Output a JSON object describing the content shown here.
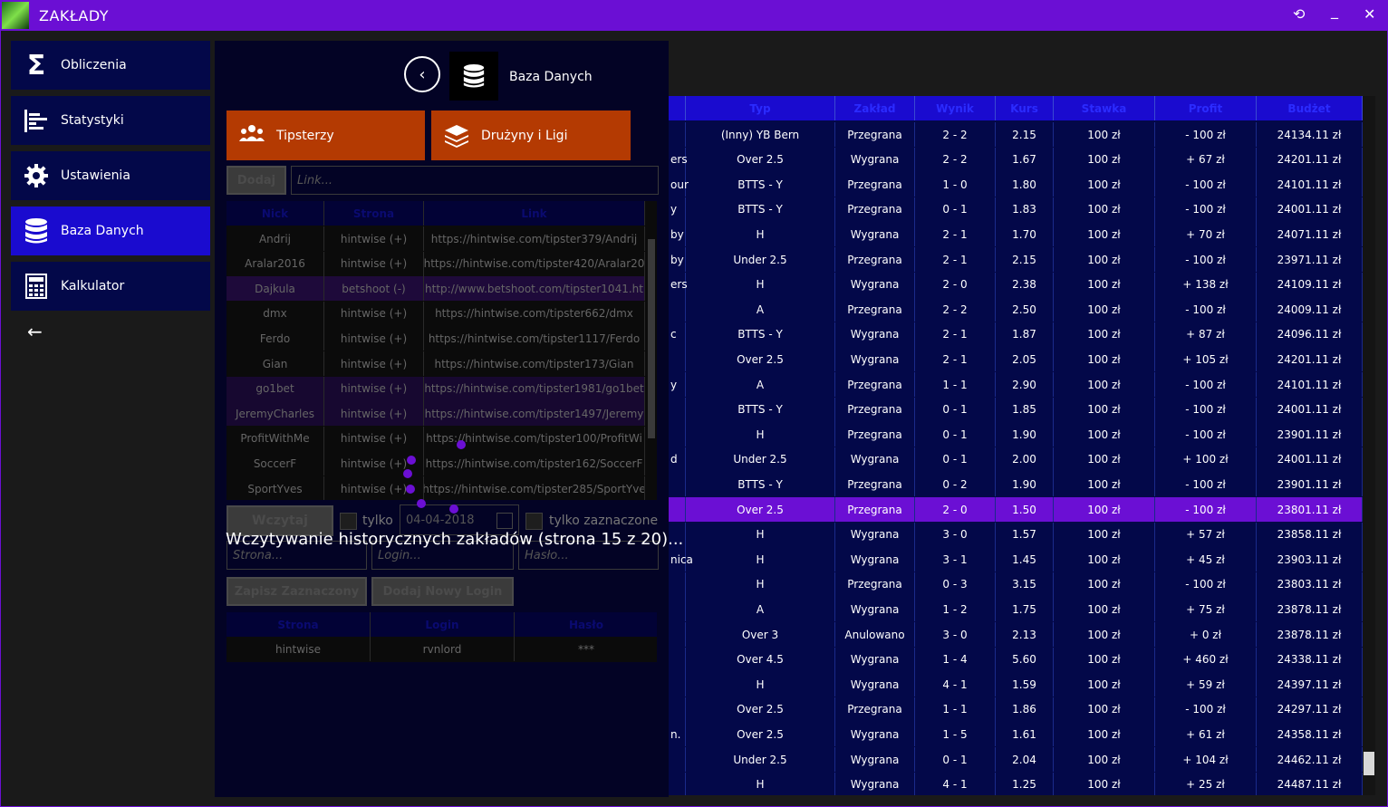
{
  "app": {
    "title": "ZAKŁADY"
  },
  "nav": [
    {
      "label": "Obliczenia",
      "icon": "sigma-icon"
    },
    {
      "label": "Statystyki",
      "icon": "stats-icon"
    },
    {
      "label": "Ustawienia",
      "icon": "gear-icon"
    },
    {
      "label": "Baza Danych",
      "icon": "database-icon"
    },
    {
      "label": "Kalkulator",
      "icon": "calculator-icon"
    }
  ],
  "panel": {
    "title": "Baza Danych",
    "tile_tipsters": "Tipsterzy",
    "tile_teams": "Drużyny i Ligi",
    "add_button": "Dodaj",
    "link_placeholder": "Link...",
    "tipsters_headers": [
      "Nick",
      "Strona",
      "Link"
    ],
    "tipsters": [
      {
        "nick": "Andrij",
        "site": "hintwise (+)",
        "link": "https://hintwise.com/tipster379/Andrij"
      },
      {
        "nick": "Aralar2016",
        "site": "hintwise (+)",
        "link": "https://hintwise.com/tipster420/Aralar20"
      },
      {
        "nick": "Dajkula",
        "site": "betshoot (-)",
        "link": "http://www.betshoot.com/tipster1041.ht"
      },
      {
        "nick": "dmx",
        "site": "hintwise (+)",
        "link": "https://hintwise.com/tipster662/dmx"
      },
      {
        "nick": "Ferdo",
        "site": "hintwise (+)",
        "link": "https://hintwise.com/tipster1117/Ferdo"
      },
      {
        "nick": "Gian",
        "site": "hintwise (+)",
        "link": "https://hintwise.com/tipster173/Gian"
      },
      {
        "nick": "go1bet",
        "site": "hintwise (+)",
        "link": "https://hintwise.com/tipster1981/go1bet"
      },
      {
        "nick": "JeremyCharles",
        "site": "hintwise (+)",
        "link": "https://hintwise.com/tipster1497/Jeremy"
      },
      {
        "nick": "ProfitWithMe",
        "site": "hintwise (+)",
        "link": "https://hintwise.com/tipster100/ProfitWi"
      },
      {
        "nick": "SoccerF",
        "site": "hintwise (+)",
        "link": "https://hintwise.com/tipster162/SoccerF"
      },
      {
        "nick": "SportYves",
        "site": "hintwise (+)",
        "link": "https://hintwise.com/tipster285/SportYve"
      }
    ],
    "load_button": "Wczytaj",
    "only_label": "tylko",
    "date_value": "04-04-2018",
    "only_selected_label": "tylko zaznaczone",
    "loading_text": "Wczytywanie historycznych zakładów (strona 15 z 20)...",
    "page_placeholder": "Strona...",
    "login_placeholder": "Login...",
    "password_placeholder": "Hasło...",
    "save_selected": "Zapisz Zaznaczony",
    "add_login": "Dodaj Nowy Login",
    "logins_headers": [
      "Strona",
      "Login",
      "Hasło"
    ],
    "logins": [
      {
        "site": "hintwise",
        "login": "rvnlord",
        "password": "***"
      }
    ]
  },
  "bets_headers": [
    "Typ",
    "Zakład",
    "Wynik",
    "Kurs",
    "Stawka",
    "Profit",
    "Budżet"
  ],
  "bets": [
    {
      "frag": "",
      "typ": "(Inny) YB Bern",
      "zaklad": "Przegrana",
      "wynik": "2 - 2",
      "kurs": "2.15",
      "stawka": "100 zł",
      "profit": "- 100 zł",
      "budzet": "24134.11 zł"
    },
    {
      "frag": "ers",
      "typ": "Over 2.5",
      "zaklad": "Wygrana",
      "wynik": "2 - 2",
      "kurs": "1.67",
      "stawka": "100 zł",
      "profit": "+ 67 zł",
      "budzet": "24201.11 zł"
    },
    {
      "frag": "our",
      "typ": "BTTS - Y",
      "zaklad": "Przegrana",
      "wynik": "1 - 0",
      "kurs": "1.80",
      "stawka": "100 zł",
      "profit": "- 100 zł",
      "budzet": "24101.11 zł"
    },
    {
      "frag": "y",
      "typ": "BTTS - Y",
      "zaklad": "Przegrana",
      "wynik": "0 - 1",
      "kurs": "1.83",
      "stawka": "100 zł",
      "profit": "- 100 zł",
      "budzet": "24001.11 zł"
    },
    {
      "frag": "by",
      "typ": "H",
      "zaklad": "Wygrana",
      "wynik": "2 - 1",
      "kurs": "1.70",
      "stawka": "100 zł",
      "profit": "+ 70 zł",
      "budzet": "24071.11 zł"
    },
    {
      "frag": "by",
      "typ": "Under 2.5",
      "zaklad": "Przegrana",
      "wynik": "2 - 1",
      "kurs": "2.15",
      "stawka": "100 zł",
      "profit": "- 100 zł",
      "budzet": "23971.11 zł"
    },
    {
      "frag": "ers",
      "typ": "H",
      "zaklad": "Wygrana",
      "wynik": "2 - 0",
      "kurs": "2.38",
      "stawka": "100 zł",
      "profit": "+ 138 zł",
      "budzet": "24109.11 zł"
    },
    {
      "frag": "",
      "typ": "A",
      "zaklad": "Przegrana",
      "wynik": "2 - 2",
      "kurs": "2.50",
      "stawka": "100 zł",
      "profit": "- 100 zł",
      "budzet": "24009.11 zł"
    },
    {
      "frag": "c",
      "typ": "BTTS - Y",
      "zaklad": "Wygrana",
      "wynik": "2 - 1",
      "kurs": "1.87",
      "stawka": "100 zł",
      "profit": "+ 87 zł",
      "budzet": "24096.11 zł"
    },
    {
      "frag": "",
      "typ": "Over 2.5",
      "zaklad": "Wygrana",
      "wynik": "2 - 1",
      "kurs": "2.05",
      "stawka": "100 zł",
      "profit": "+ 105 zł",
      "budzet": "24201.11 zł"
    },
    {
      "frag": "y",
      "typ": "A",
      "zaklad": "Przegrana",
      "wynik": "1 - 1",
      "kurs": "2.90",
      "stawka": "100 zł",
      "profit": "- 100 zł",
      "budzet": "24101.11 zł"
    },
    {
      "frag": "",
      "typ": "BTTS - Y",
      "zaklad": "Przegrana",
      "wynik": "0 - 1",
      "kurs": "1.85",
      "stawka": "100 zł",
      "profit": "- 100 zł",
      "budzet": "24001.11 zł"
    },
    {
      "frag": "",
      "typ": "H",
      "zaklad": "Przegrana",
      "wynik": "0 - 1",
      "kurs": "1.90",
      "stawka": "100 zł",
      "profit": "- 100 zł",
      "budzet": "23901.11 zł"
    },
    {
      "frag": "d",
      "typ": "Under 2.5",
      "zaklad": "Wygrana",
      "wynik": "0 - 1",
      "kurs": "2.00",
      "stawka": "100 zł",
      "profit": "+ 100 zł",
      "budzet": "24001.11 zł"
    },
    {
      "frag": "",
      "typ": "BTTS - Y",
      "zaklad": "Przegrana",
      "wynik": "0 - 2",
      "kurs": "1.90",
      "stawka": "100 zł",
      "profit": "- 100 zł",
      "budzet": "23901.11 zł"
    },
    {
      "frag": "",
      "typ": "Over 2.5",
      "zaklad": "Przegrana",
      "wynik": "2 - 0",
      "kurs": "1.50",
      "stawka": "100 zł",
      "profit": "- 100 zł",
      "budzet": "23801.11 zł",
      "selected": true
    },
    {
      "frag": "",
      "typ": "H",
      "zaklad": "Wygrana",
      "wynik": "3 - 0",
      "kurs": "1.57",
      "stawka": "100 zł",
      "profit": "+ 57 zł",
      "budzet": "23858.11 zł"
    },
    {
      "frag": "nica",
      "typ": "H",
      "zaklad": "Wygrana",
      "wynik": "3 - 1",
      "kurs": "1.45",
      "stawka": "100 zł",
      "profit": "+ 45 zł",
      "budzet": "23903.11 zł"
    },
    {
      "frag": "",
      "typ": "H",
      "zaklad": "Przegrana",
      "wynik": "0 - 3",
      "kurs": "3.15",
      "stawka": "100 zł",
      "profit": "- 100 zł",
      "budzet": "23803.11 zł"
    },
    {
      "frag": "",
      "typ": "A",
      "zaklad": "Wygrana",
      "wynik": "1 - 2",
      "kurs": "1.75",
      "stawka": "100 zł",
      "profit": "+ 75 zł",
      "budzet": "23878.11 zł"
    },
    {
      "frag": "",
      "typ": "Over 3",
      "zaklad": "Anulowano",
      "wynik": "3 - 0",
      "kurs": "2.13",
      "stawka": "100 zł",
      "profit": "+ 0 zł",
      "budzet": "23878.11 zł"
    },
    {
      "frag": "",
      "typ": "Over 4.5",
      "zaklad": "Wygrana",
      "wynik": "1 - 4",
      "kurs": "5.60",
      "stawka": "100 zł",
      "profit": "+ 460 zł",
      "budzet": "24338.11 zł"
    },
    {
      "frag": "",
      "typ": "H",
      "zaklad": "Wygrana",
      "wynik": "4 - 1",
      "kurs": "1.59",
      "stawka": "100 zł",
      "profit": "+ 59 zł",
      "budzet": "24397.11 zł"
    },
    {
      "frag": "",
      "typ": "Over 2.5",
      "zaklad": "Przegrana",
      "wynik": "1 - 1",
      "kurs": "1.86",
      "stawka": "100 zł",
      "profit": "- 100 zł",
      "budzet": "24297.11 zł"
    },
    {
      "frag": "n.",
      "typ": "Over 2.5",
      "zaklad": "Wygrana",
      "wynik": "1 - 5",
      "kurs": "1.61",
      "stawka": "100 zł",
      "profit": "+ 61 zł",
      "budzet": "24358.11 zł"
    },
    {
      "frag": "",
      "typ": "Under 2.5",
      "zaklad": "Wygrana",
      "wynik": "0 - 1",
      "kurs": "2.04",
      "stawka": "100 zł",
      "profit": "+ 104 zł",
      "budzet": "24462.11 zł"
    },
    {
      "frag": "",
      "typ": "H",
      "zaklad": "Wygrana",
      "wynik": "4 - 1",
      "kurs": "1.25",
      "stawka": "100 zł",
      "profit": "+ 25 zł",
      "budzet": "24487.11 zł"
    }
  ],
  "colors": {
    "titlebar": "#6b0fd4",
    "nav_bg": "#030849",
    "nav_active": "#1a0bcf",
    "tile": "#b43a02",
    "selected_row": "#6b0fd4"
  }
}
